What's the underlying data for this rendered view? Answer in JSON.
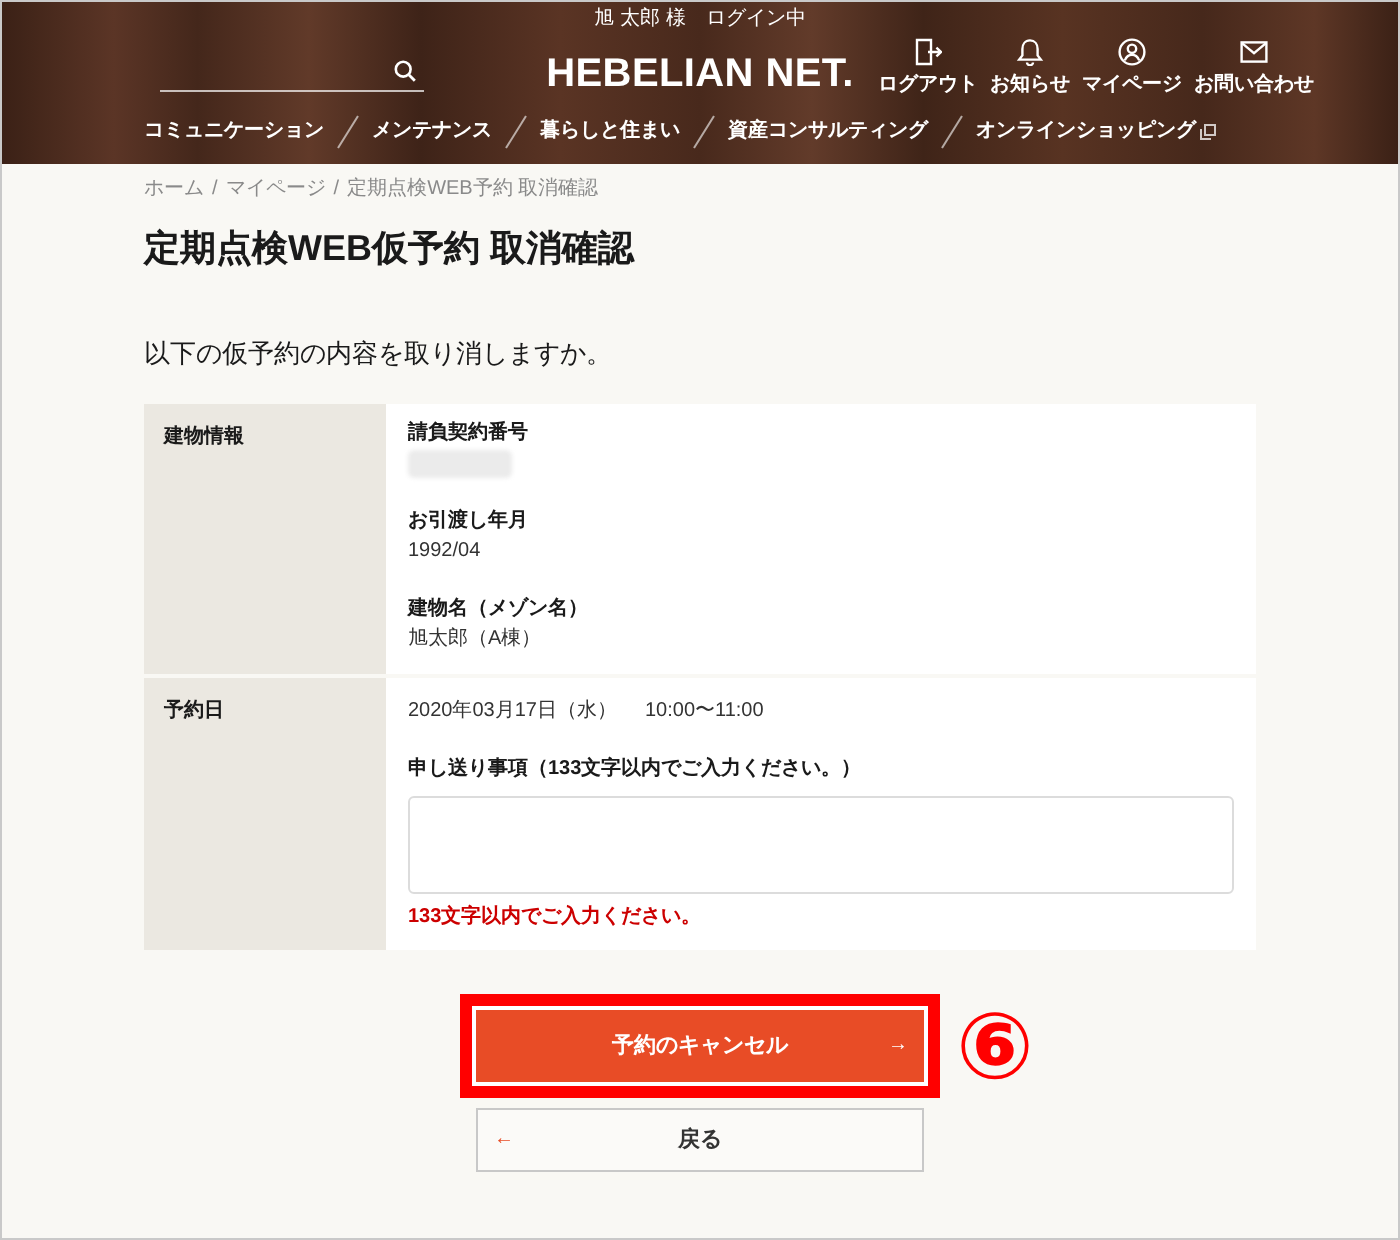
{
  "header": {
    "login_status": "旭 太郎 様　ログイン中",
    "logo": "HEBELIAN NET.",
    "utility_links": [
      {
        "kind": "logout",
        "label": "ログアウト"
      },
      {
        "kind": "notifications",
        "label": "お知らせ"
      },
      {
        "kind": "mypage",
        "label": "マイページ"
      },
      {
        "kind": "contact",
        "label": "お問い合わせ"
      }
    ],
    "nav": [
      {
        "label": "コミュニケーション",
        "external": false
      },
      {
        "label": "メンテナンス",
        "external": false
      },
      {
        "label": "暮らしと住まい",
        "external": false
      },
      {
        "label": "資産コンサルティング",
        "external": false
      },
      {
        "label": "オンラインショッピング",
        "external": true
      }
    ]
  },
  "breadcrumb": {
    "separator": "/",
    "items": [
      "ホーム",
      "マイページ",
      "定期点検WEB予約 取消確認"
    ]
  },
  "title": "定期点検WEB仮予約 取消確認",
  "prompt": "以下の仮予約の内容を取り消しますか。",
  "details": [
    {
      "label": "建物情報",
      "fields": [
        {
          "kind": "redacted",
          "label": "請負契約番号"
        },
        {
          "kind": "text",
          "label": "お引渡し年月",
          "value": "1992/04"
        },
        {
          "kind": "text",
          "label": "建物名（メゾン名）",
          "value": "旭太郎（A棟）"
        }
      ]
    },
    {
      "label": "予約日",
      "fields": [
        {
          "kind": "datetime",
          "date": "2020年03月17日（水）",
          "time": "10:00〜11:00"
        },
        {
          "kind": "textarea",
          "label": "申し送り事項（133文字以内でご入力ください。）",
          "error": "133文字以内でご入力ください。"
        }
      ]
    }
  ],
  "buttons": [
    {
      "kind": "primary",
      "label": "予約のキャンセル",
      "arrow": "→",
      "highlighted": true
    },
    {
      "kind": "secondary",
      "label": "戻る",
      "arrow": "←",
      "highlighted": false
    }
  ],
  "annotation": {
    "label": "⑥"
  }
}
